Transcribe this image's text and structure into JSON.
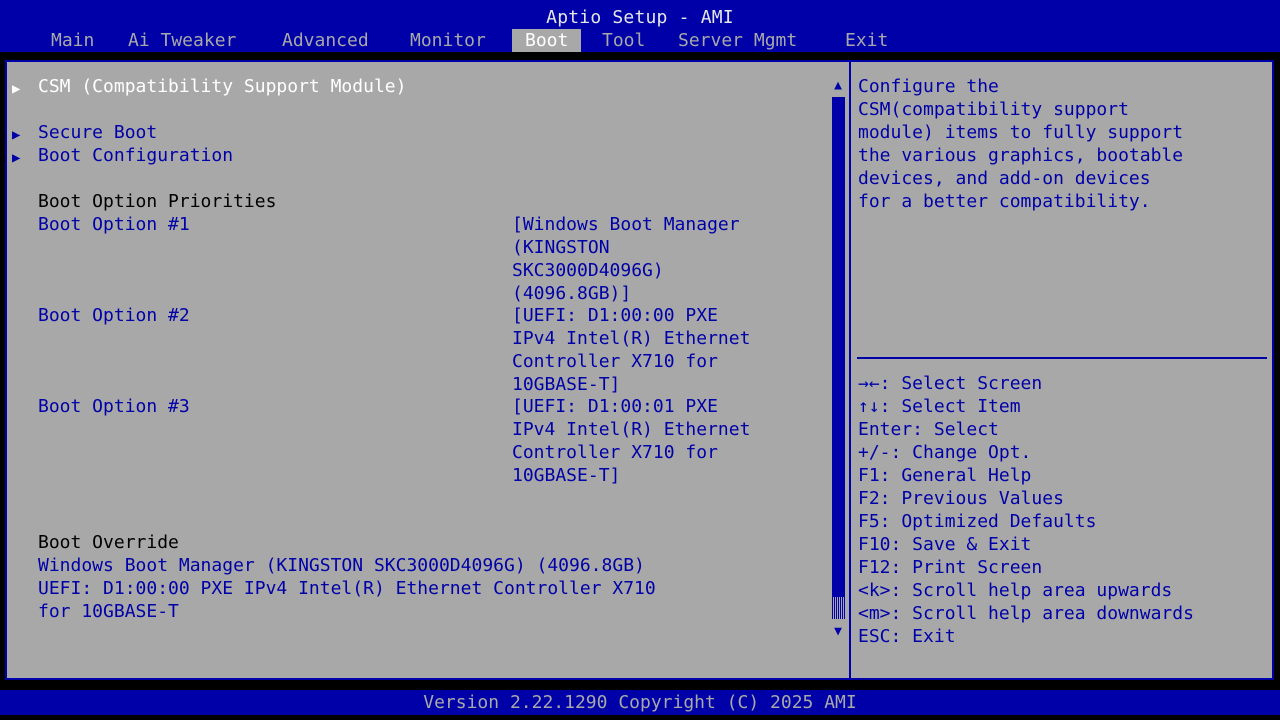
{
  "window": {
    "title": "Aptio Setup - AMI"
  },
  "tabs": [
    {
      "label": "Main"
    },
    {
      "label": "Ai Tweaker"
    },
    {
      "label": "Advanced"
    },
    {
      "label": "Monitor"
    },
    {
      "label": "Boot",
      "active": true
    },
    {
      "label": "Tool"
    },
    {
      "label": "Server Mgmt"
    },
    {
      "label": "Exit"
    }
  ],
  "menu": {
    "csm": "CSM (Compatibility Support Module)",
    "secure_boot": "Secure Boot",
    "boot_configuration": "Boot Configuration",
    "boot_option_priorities": "Boot Option Priorities",
    "boot_options": [
      {
        "label": "Boot Option #1",
        "value_lines": [
          "[Windows Boot Manager",
          "(KINGSTON",
          "SKC3000D4096G)",
          "(4096.8GB)]"
        ]
      },
      {
        "label": "Boot Option #2",
        "value_lines": [
          "[UEFI: D1:00:00 PXE",
          "IPv4 Intel(R) Ethernet",
          "Controller X710 for",
          "10GBASE-T]"
        ]
      },
      {
        "label": "Boot Option #3",
        "value_lines": [
          "[UEFI: D1:00:01 PXE",
          "IPv4 Intel(R) Ethernet",
          "Controller X710 for",
          "10GBASE-T]"
        ]
      }
    ],
    "boot_override": {
      "heading": "Boot Override",
      "items": [
        {
          "lines": [
            "Windows Boot Manager (KINGSTON SKC3000D4096G) (4096.8GB)"
          ]
        },
        {
          "lines": [
            "UEFI: D1:00:00 PXE IPv4 Intel(R) Ethernet Controller X710",
            "for 10GBASE-T"
          ]
        }
      ]
    }
  },
  "help": {
    "description_lines": [
      "Configure the",
      "CSM(compatibility support",
      "module) items to fully support",
      "the various graphics, bootable",
      "devices, and add-on devices",
      "for a better compatibility."
    ],
    "keys": [
      "→←: Select Screen",
      "↑↓: Select Item",
      "Enter: Select",
      "+/-: Change Opt.",
      "F1: General Help",
      "F2: Previous Values",
      "F5: Optimized Defaults",
      "F10: Save & Exit",
      "F12: Print Screen",
      "<k>: Scroll help area upwards",
      "<m>: Scroll help area downwards",
      "ESC: Exit"
    ]
  },
  "footer": {
    "version": "Version 2.22.1290 Copyright (C) 2025 AMI"
  },
  "colors": {
    "blue": "#0000a8",
    "gray": "#a8a8a8",
    "white": "#ffffff"
  }
}
